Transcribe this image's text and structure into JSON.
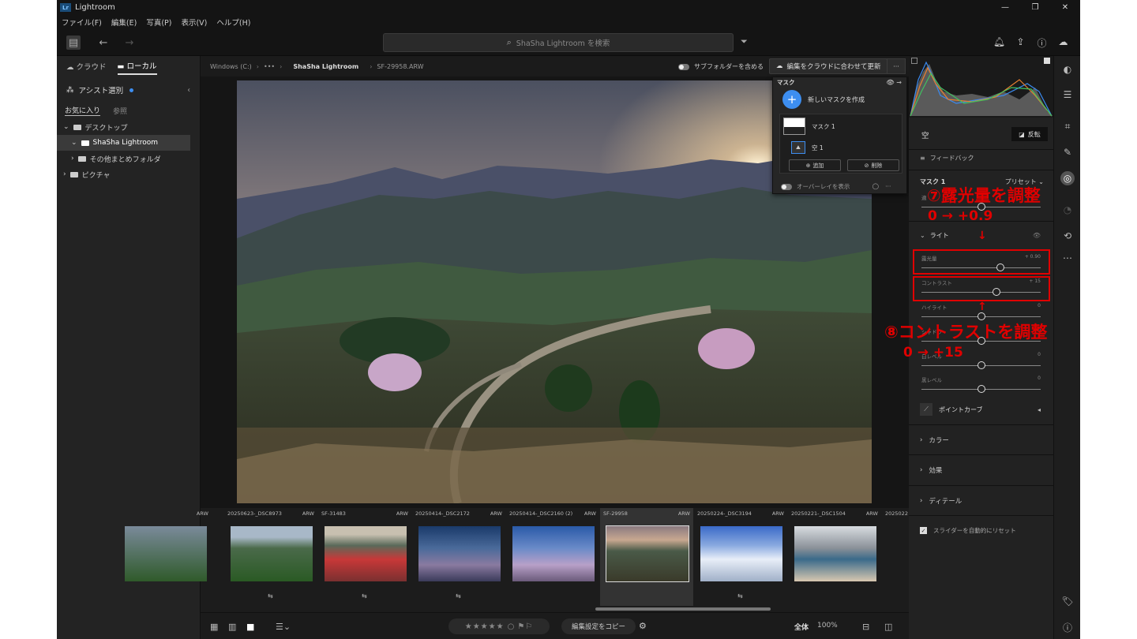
{
  "app": {
    "title": "Lightroom",
    "logo": "Lr"
  },
  "menu": [
    "ファイル(F)",
    "編集(E)",
    "写真(P)",
    "表示(V)",
    "ヘルプ(H)"
  ],
  "search": {
    "placeholder": "ShaSha Lightroom を検索"
  },
  "left": {
    "tab_cloud": "クラウド",
    "tab_local": "ローカル",
    "assist": "アシスト選別",
    "sub_fav": "お気に入り",
    "sub_browse": "参照",
    "tree": [
      "デスクトップ",
      "ShaSha Lightroom",
      "その他まとめフォルダ",
      "ピクチャ"
    ]
  },
  "breadcrumb": {
    "drive": "Windows (C:)",
    "dots": "•••",
    "folder": "ShaSha Lightroom",
    "file": "SF-29958.ARW"
  },
  "subfolder_label": "サブフォルダーを含める",
  "sync_label": "編集をクラウドに合わせて更新",
  "more_label": "···",
  "mask": {
    "title": "マスク",
    "new_label": "新しいマスクを作成",
    "mask1": "マスク 1",
    "sky": "空 1",
    "add": "追加",
    "del": "削除",
    "overlay": "オーバーレイを表示"
  },
  "filmstrip": [
    {
      "name": "",
      "fmt": "ARW"
    },
    {
      "name": "20250623-_DSC8973",
      "fmt": "ARW"
    },
    {
      "name": "SF-31483",
      "fmt": "ARW"
    },
    {
      "name": "20250414-_DSC2172",
      "fmt": "ARW"
    },
    {
      "name": "20250414-_DSC2160 (2)",
      "fmt": "ARW"
    },
    {
      "name": "SF-29958",
      "fmt": "ARW"
    },
    {
      "name": "20250224-_DSC3194",
      "fmt": "ARW"
    },
    {
      "name": "20250221-_DSC1504",
      "fmt": "ARW"
    },
    {
      "name": "2025022",
      "fmt": ""
    }
  ],
  "bottom": {
    "stars": "★★★★★",
    "copy": "編集設定をコピー",
    "zoom_label": "全体",
    "zoom_value": "100%"
  },
  "right": {
    "header": "空",
    "invert": "反転",
    "feedback": "フィードバック",
    "mask_name": "マスク 1",
    "preset": "プリセット",
    "amount_label": "適",
    "light": "ライト",
    "sliders": [
      {
        "label": "露光量",
        "value": "+ 0.90"
      },
      {
        "label": "コントラスト",
        "value": "+ 15"
      },
      {
        "label": "ハイライト",
        "value": "0"
      },
      {
        "label": "シャドウ",
        "value": "0"
      },
      {
        "label": "白レベル",
        "value": "0"
      },
      {
        "label": "黒レベル",
        "value": "0"
      }
    ],
    "slider_levels": [
      0.66,
      0.63,
      0.5,
      0.5,
      0.5,
      0.5
    ],
    "point_curve": "ポイントカーブ",
    "sections": [
      "カラー",
      "効果",
      "ディテール"
    ],
    "auto_reset": "スライダーを自動的にリセット"
  },
  "annotations": {
    "a7_title": "⑦露光量を調整",
    "a7_change": "0 → +0.9",
    "a8_title": "⑧コントラストを調整",
    "a8_change": "0 → +15"
  },
  "colors": {
    "accent": "#3d8ef0",
    "annotation": "#e00000"
  }
}
